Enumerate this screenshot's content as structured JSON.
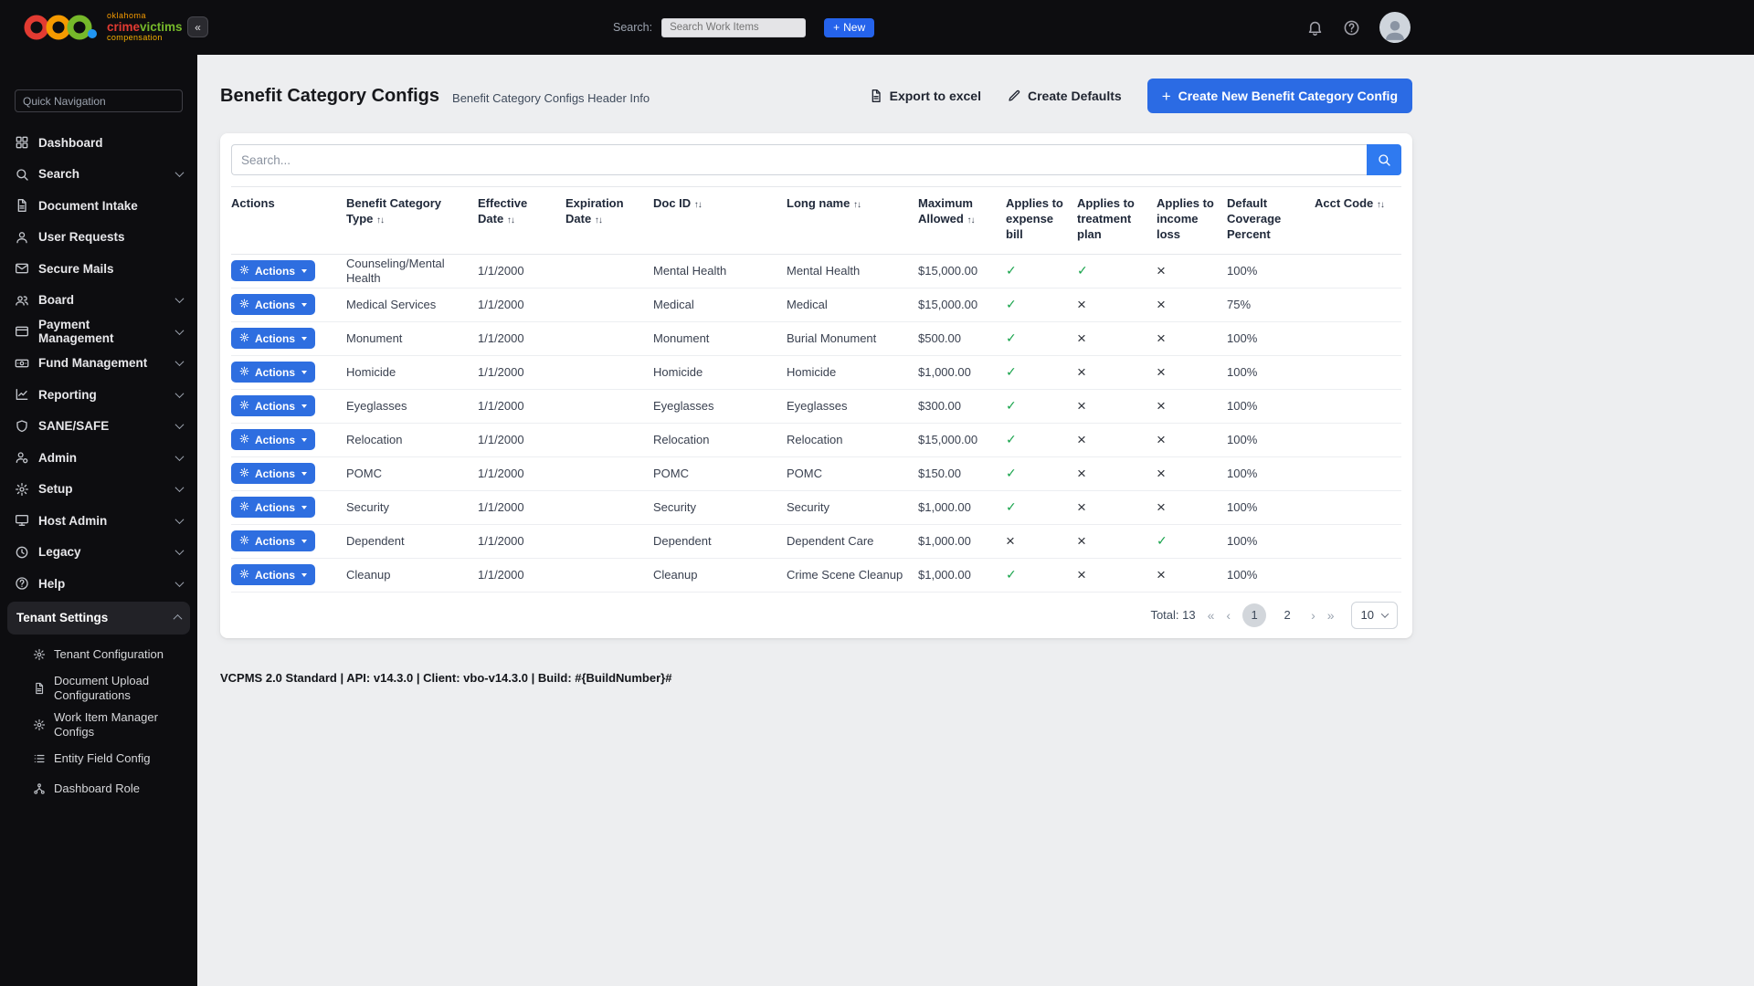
{
  "brand": {
    "word1": "oklahoma",
    "word2a": "crime",
    "word2b": "victims",
    "word3": "compensation"
  },
  "topbar": {
    "collapse_glyph": "«",
    "search_label": "Search:",
    "search_placeholder": "Search Work Items",
    "new_button_plus": "+",
    "new_button_label": "New"
  },
  "sidebar": {
    "quick_nav_placeholder": "Quick Navigation",
    "items": [
      {
        "label": "Dashboard",
        "icon": "dashboard-icon",
        "expandable": false
      },
      {
        "label": "Search",
        "icon": "search-icon",
        "expandable": true
      },
      {
        "label": "Document Intake",
        "icon": "document-icon",
        "expandable": false
      },
      {
        "label": "User Requests",
        "icon": "user-icon",
        "expandable": false
      },
      {
        "label": "Secure Mails",
        "icon": "mail-icon",
        "expandable": false
      },
      {
        "label": "Board",
        "icon": "board-icon",
        "expandable": true
      },
      {
        "label": "Payment Management",
        "icon": "payment-icon",
        "expandable": true
      },
      {
        "label": "Fund Management",
        "icon": "fund-icon",
        "expandable": true
      },
      {
        "label": "Reporting",
        "icon": "reporting-icon",
        "expandable": true
      },
      {
        "label": "SANE/SAFE",
        "icon": "shield-icon",
        "expandable": true
      },
      {
        "label": "Admin",
        "icon": "admin-icon",
        "expandable": true
      },
      {
        "label": "Setup",
        "icon": "setup-icon",
        "expandable": true
      },
      {
        "label": "Host Admin",
        "icon": "host-admin-icon",
        "expandable": true
      },
      {
        "label": "Legacy",
        "icon": "legacy-icon",
        "expandable": true
      },
      {
        "label": "Help",
        "icon": "help-icon",
        "expandable": true
      },
      {
        "label": "Tenant Settings",
        "icon": null,
        "expandable": true,
        "expanded": true,
        "active": true
      }
    ],
    "sub_items": [
      {
        "label": "Tenant Configuration",
        "icon": "tenant-config-icon"
      },
      {
        "label": "Document Upload Configurations",
        "icon": "doc-upload-icon"
      },
      {
        "label": "Work Item Manager Configs",
        "icon": "work-item-icon"
      },
      {
        "label": "Entity Field Config",
        "icon": "entity-field-icon"
      },
      {
        "label": "Dashboard Role",
        "icon": "dashboard-role-icon"
      }
    ]
  },
  "page": {
    "title": "Benefit Category Configs",
    "subtitle": "Benefit Category Configs Header Info",
    "export_button": "Export to excel",
    "create_defaults_button": "Create Defaults",
    "create_new_plus": "+",
    "create_new_button": "Create New Benefit Category Config"
  },
  "table": {
    "search_placeholder": "Search...",
    "actions_button_label": "Actions",
    "sort_glyph": "↑↓",
    "check_glyph": "✓",
    "cross_glyph": "×",
    "columns": [
      {
        "label": "Actions",
        "sortable": false
      },
      {
        "label": "Benefit Category Type",
        "sortable": true
      },
      {
        "label": "Effective Date",
        "sortable": true
      },
      {
        "label": "Expiration Date",
        "sortable": true
      },
      {
        "label": "Doc ID",
        "sortable": true
      },
      {
        "label": "Long name",
        "sortable": true
      },
      {
        "label": "Maximum Allowed",
        "sortable": true
      },
      {
        "label": "Applies to expense bill",
        "sortable": false
      },
      {
        "label": "Applies to treatment plan",
        "sortable": false
      },
      {
        "label": "Applies to income loss",
        "sortable": false
      },
      {
        "label": "Default Coverage Percent",
        "sortable": false
      },
      {
        "label": "Acct Code",
        "sortable": true
      }
    ],
    "rows": [
      {
        "benefit_category_type": "Counseling/Mental Health",
        "effective_date": "1/1/2000",
        "expiration_date": "",
        "doc_id": "Mental Health",
        "long_name": "Mental Health",
        "maximum_allowed": "$15,000.00",
        "applies_to_expense_bill": true,
        "applies_to_treatment_plan": true,
        "applies_to_income_loss": false,
        "default_coverage_percent": "100%",
        "acct_code": ""
      },
      {
        "benefit_category_type": "Medical Services",
        "effective_date": "1/1/2000",
        "expiration_date": "",
        "doc_id": "Medical",
        "long_name": "Medical",
        "maximum_allowed": "$15,000.00",
        "applies_to_expense_bill": true,
        "applies_to_treatment_plan": false,
        "applies_to_income_loss": false,
        "default_coverage_percent": "75%",
        "acct_code": ""
      },
      {
        "benefit_category_type": "Monument",
        "effective_date": "1/1/2000",
        "expiration_date": "",
        "doc_id": "Monument",
        "long_name": "Burial Monument",
        "maximum_allowed": "$500.00",
        "applies_to_expense_bill": true,
        "applies_to_treatment_plan": false,
        "applies_to_income_loss": false,
        "default_coverage_percent": "100%",
        "acct_code": ""
      },
      {
        "benefit_category_type": "Homicide",
        "effective_date": "1/1/2000",
        "expiration_date": "",
        "doc_id": "Homicide",
        "long_name": "Homicide",
        "maximum_allowed": "$1,000.00",
        "applies_to_expense_bill": true,
        "applies_to_treatment_plan": false,
        "applies_to_income_loss": false,
        "default_coverage_percent": "100%",
        "acct_code": ""
      },
      {
        "benefit_category_type": "Eyeglasses",
        "effective_date": "1/1/2000",
        "expiration_date": "",
        "doc_id": "Eyeglasses",
        "long_name": "Eyeglasses",
        "maximum_allowed": "$300.00",
        "applies_to_expense_bill": true,
        "applies_to_treatment_plan": false,
        "applies_to_income_loss": false,
        "default_coverage_percent": "100%",
        "acct_code": ""
      },
      {
        "benefit_category_type": "Relocation",
        "effective_date": "1/1/2000",
        "expiration_date": "",
        "doc_id": "Relocation",
        "long_name": "Relocation",
        "maximum_allowed": "$15,000.00",
        "applies_to_expense_bill": true,
        "applies_to_treatment_plan": false,
        "applies_to_income_loss": false,
        "default_coverage_percent": "100%",
        "acct_code": ""
      },
      {
        "benefit_category_type": "POMC",
        "effective_date": "1/1/2000",
        "expiration_date": "",
        "doc_id": "POMC",
        "long_name": "POMC",
        "maximum_allowed": "$150.00",
        "applies_to_expense_bill": true,
        "applies_to_treatment_plan": false,
        "applies_to_income_loss": false,
        "default_coverage_percent": "100%",
        "acct_code": ""
      },
      {
        "benefit_category_type": "Security",
        "effective_date": "1/1/2000",
        "expiration_date": "",
        "doc_id": "Security",
        "long_name": "Security",
        "maximum_allowed": "$1,000.00",
        "applies_to_expense_bill": true,
        "applies_to_treatment_plan": false,
        "applies_to_income_loss": false,
        "default_coverage_percent": "100%",
        "acct_code": ""
      },
      {
        "benefit_category_type": "Dependent",
        "effective_date": "1/1/2000",
        "expiration_date": "",
        "doc_id": "Dependent",
        "long_name": "Dependent Care",
        "maximum_allowed": "$1,000.00",
        "applies_to_expense_bill": false,
        "applies_to_treatment_plan": false,
        "applies_to_income_loss": true,
        "default_coverage_percent": "100%",
        "acct_code": ""
      },
      {
        "benefit_category_type": "Cleanup",
        "effective_date": "1/1/2000",
        "expiration_date": "",
        "doc_id": "Cleanup",
        "long_name": "Crime Scene Cleanup",
        "maximum_allowed": "$1,000.00",
        "applies_to_expense_bill": true,
        "applies_to_treatment_plan": false,
        "applies_to_income_loss": false,
        "default_coverage_percent": "100%",
        "acct_code": ""
      }
    ]
  },
  "pagination": {
    "total_label": "Total: 13",
    "controls": {
      "first": "«",
      "prev": "‹",
      "next": "›",
      "last": "»"
    },
    "pages": [
      "1",
      "2"
    ],
    "active_page": "1",
    "page_size": "10"
  },
  "footer": {
    "text": "VCPMS 2.0 Standard | API: v14.3.0 | Client: vbo-v14.3.0 | Build: #{BuildNumber}#"
  },
  "colors": {
    "primary_blue": "#2b6be4",
    "success_green": "#16a34a",
    "sidebar_bg": "#0d0d10",
    "main_bg": "#edeef0"
  }
}
